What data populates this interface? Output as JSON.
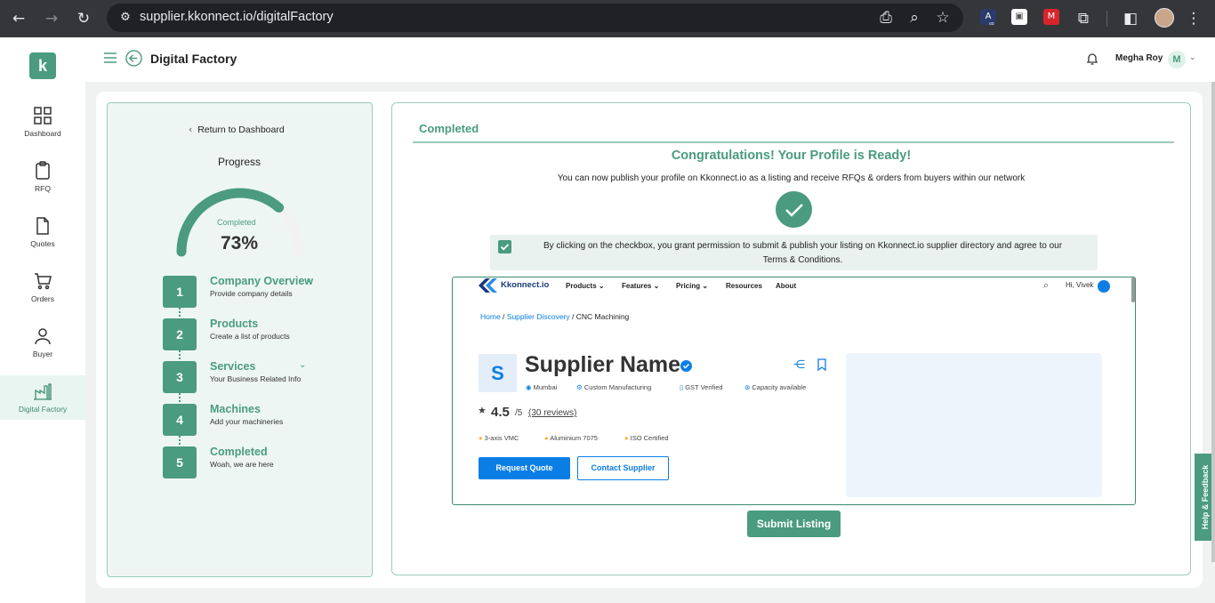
{
  "browser": {
    "url": "supplier.kkonnect.io/digitalFactory",
    "ext_badge": "∞"
  },
  "app": {
    "logo": "k",
    "nav": [
      {
        "label": "Dashboard",
        "icon": "grid-icon"
      },
      {
        "label": "RFQ",
        "icon": "clipboard-icon"
      },
      {
        "label": "Quotes",
        "icon": "document-icon"
      },
      {
        "label": "Orders",
        "icon": "cart-icon"
      },
      {
        "label": "Buyer",
        "icon": "user-icon"
      },
      {
        "label": "Digital Factory",
        "icon": "factory-icon"
      }
    ],
    "page_title": "Digital Factory",
    "user_name": "Megha Roy",
    "user_initial": "M"
  },
  "progress": {
    "return_label": "Return to Dashboard",
    "heading": "Progress",
    "gauge_label": "Completed",
    "percent_text": "73%",
    "percent_value": 0.73,
    "steps": [
      {
        "num": "1",
        "title": "Company Overview",
        "sub": "Provide company details"
      },
      {
        "num": "2",
        "title": "Products",
        "sub": "Create a list of products"
      },
      {
        "num": "3",
        "title": "Services",
        "sub": "Your Business Related Info"
      },
      {
        "num": "4",
        "title": "Machines",
        "sub": "Add your machineries"
      },
      {
        "num": "5",
        "title": "Completed",
        "sub": "Woah, we are here"
      }
    ]
  },
  "completed": {
    "tab_label": "Completed",
    "congrats": "Congratulations! Your Profile is Ready!",
    "desc": "You can now publish your profile on Kkonnect.io as a listing and receive RFQs & orders from buyers within our network",
    "consent_line1": "By clicking on the checkbox, you grant permission to submit & publish your listing on Kkonnect.io supplier directory and agree to our",
    "consent_line2": "Terms & Conditions.",
    "consent_checked": true,
    "submit_label": "Submit Listing"
  },
  "preview": {
    "brand": "Kkonnect.io",
    "nav": [
      "Products",
      "Features",
      "Pricing",
      "Resources",
      "About"
    ],
    "greeting": "Hi, Vivek",
    "breadcrumb": {
      "home": "Home",
      "sep": " / ",
      "discovery": "Supplier Discovery",
      "current": "CNC Machining"
    },
    "avatar_letter": "S",
    "supplier_name": "Supplier Name",
    "meta": [
      "Mumbai",
      "Custom Manufacturing",
      "GST Verified",
      "Capacity available"
    ],
    "rating": "4.5",
    "rating_of": "/5",
    "reviews": "(30 reviews)",
    "tags": [
      "3-axis VMC",
      "Aluminium 7075",
      "ISO Certified"
    ],
    "request_quote": "Request Quote",
    "contact_supplier": "Contact Supplier"
  },
  "feedback_label": "Help & Feedback",
  "colors": {
    "accent": "#4a9b80",
    "blue": "#0b7ee5"
  }
}
